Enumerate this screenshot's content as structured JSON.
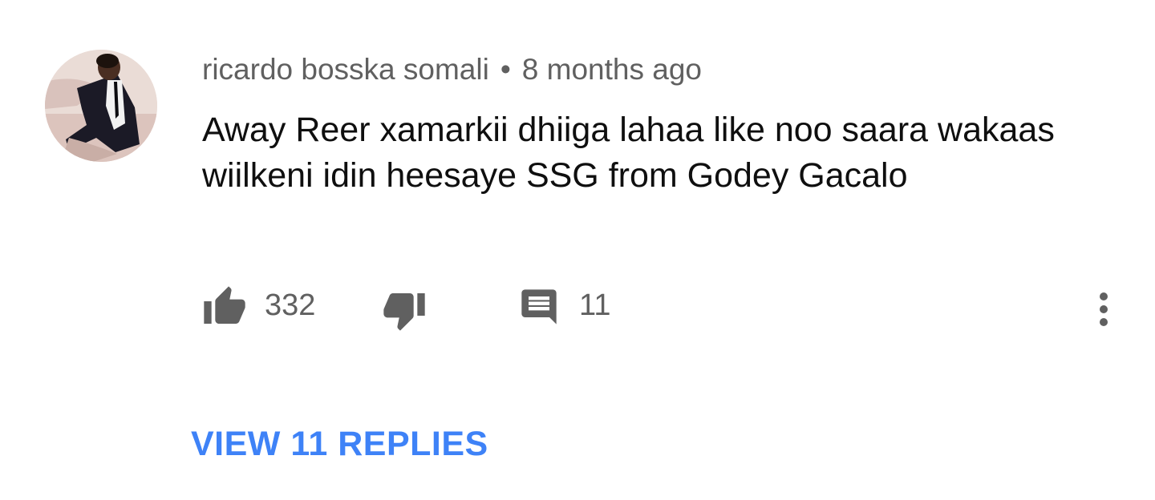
{
  "comment": {
    "author": "ricardo bosska somali",
    "separator": "•",
    "timestamp": "8 months ago",
    "text": "Away Reer xamarkii dhiiga lahaa like noo saara wakaas wiilkeni idin heesaye SSG from Godey Gacalo",
    "likes": "332",
    "replies_count": "11",
    "view_replies_label": "VIEW 11 REPLIES"
  },
  "icons": {
    "like": "thumbs-up-icon",
    "dislike": "thumbs-down-icon",
    "reply": "comment-icon",
    "more": "more-vertical-icon"
  },
  "colors": {
    "meta_text": "#606060",
    "body_text": "#0f0f0f",
    "icon": "#606060",
    "link": "#3e82f7"
  }
}
